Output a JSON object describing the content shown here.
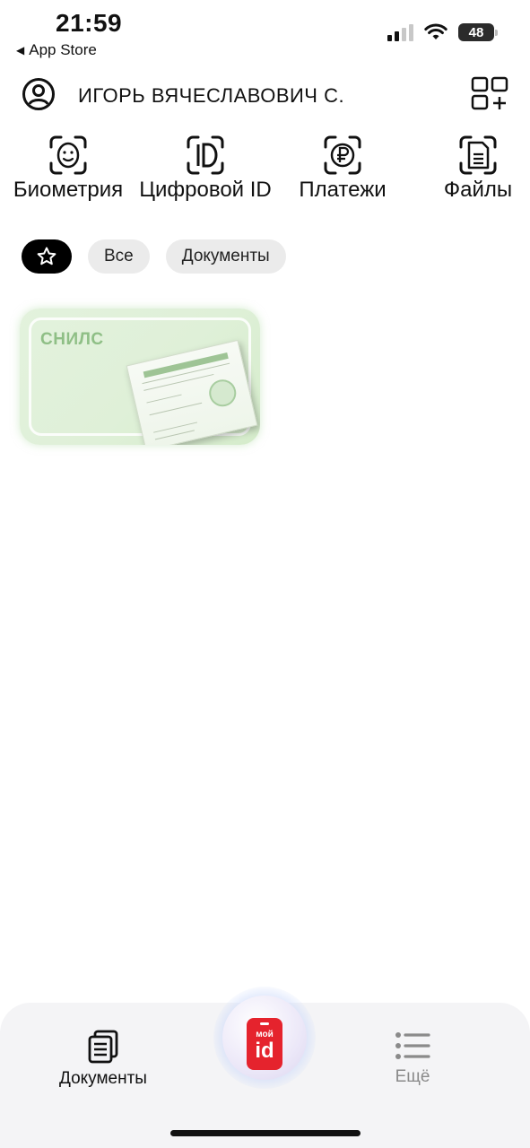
{
  "status_bar": {
    "time": "21:59",
    "back_label": "App Store",
    "battery": "48"
  },
  "header": {
    "user_name": "ИГОРЬ ВЯЧЕСЛАВОВИЧ С.",
    "avatar_icon": "user-circle-icon",
    "add_widget_icon": "add-widget-icon"
  },
  "quick_actions": [
    {
      "label": "Биометрия",
      "icon": "face-scan-icon"
    },
    {
      "label": "Цифровой ID",
      "icon": "digital-id-icon"
    },
    {
      "label": "Платежи",
      "icon": "ruble-payment-icon"
    },
    {
      "label": "Файлы",
      "icon": "file-icon"
    }
  ],
  "filters": {
    "favorites_icon": "star-icon",
    "items": [
      {
        "label": "Все"
      },
      {
        "label": "Документы"
      }
    ],
    "active": "favorites"
  },
  "documents": [
    {
      "title": "СНИЛС"
    }
  ],
  "tab_bar": {
    "documents_label": "Документы",
    "more_label": "Ещё",
    "center_logo_top": "мой",
    "center_logo_bottom": "id"
  },
  "colors": {
    "accent_red": "#e5232d",
    "card_green": "#dff0d8",
    "card_title_green": "#8fbf86",
    "chip_gray": "#ebebeb",
    "inactive_tab": "#8a8a8a"
  }
}
